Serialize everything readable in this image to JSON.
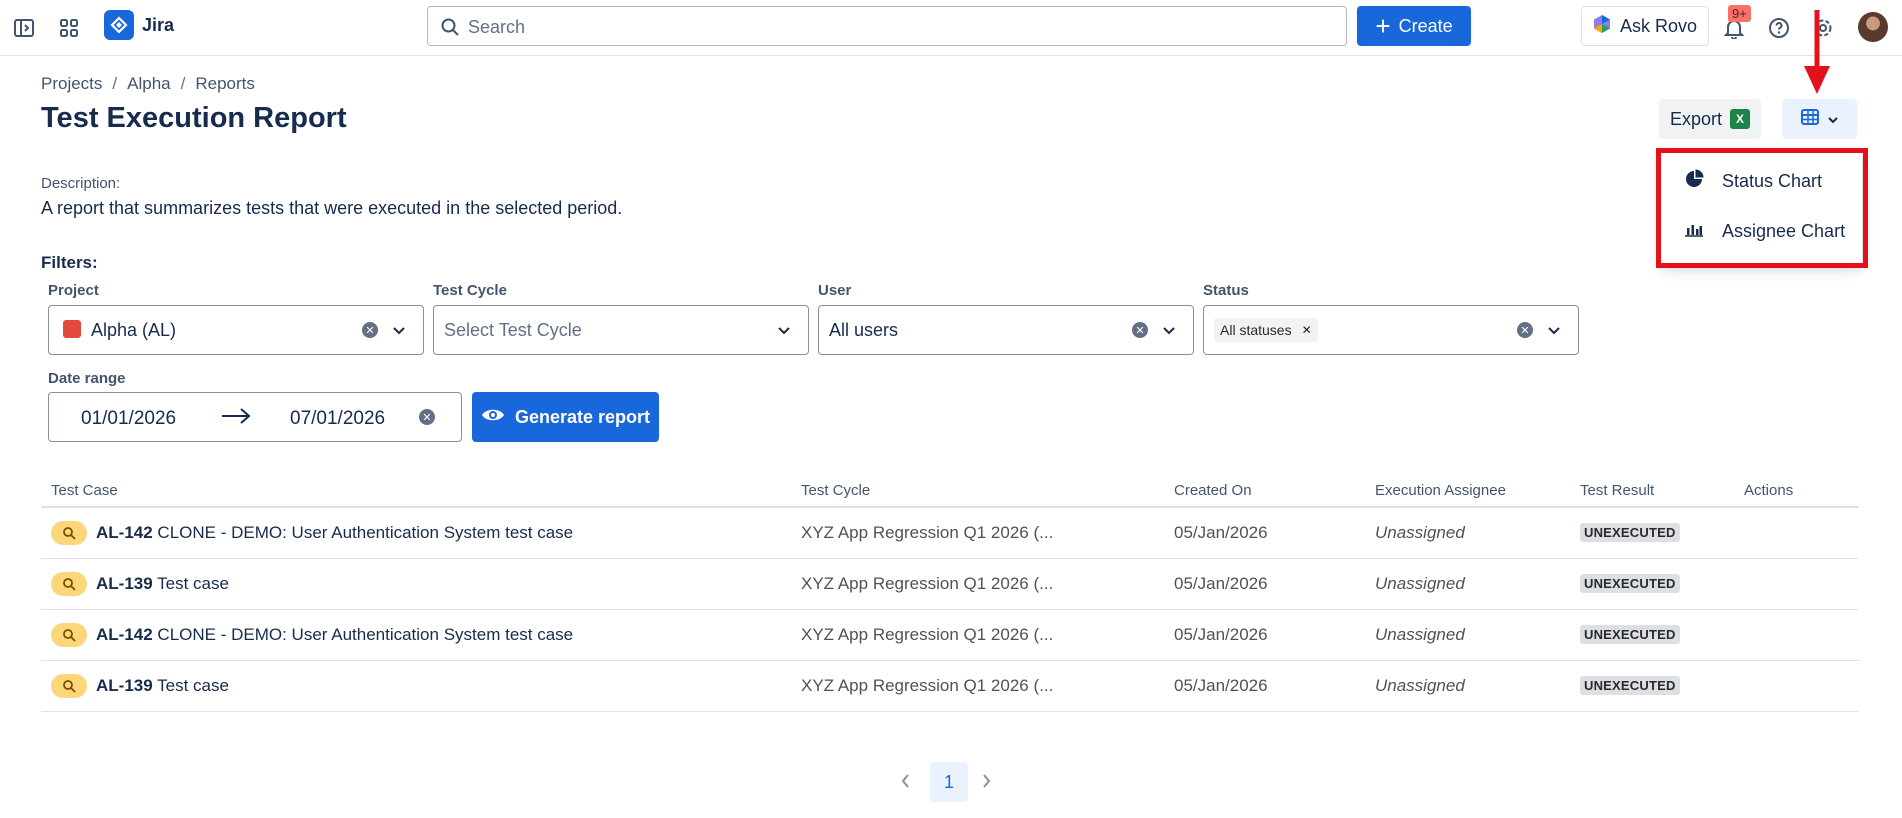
{
  "topbar": {
    "app_name": "Jira",
    "search_placeholder": "Search",
    "create_label": "Create",
    "rovo_label": "Ask Rovo",
    "notifications_count": "9+"
  },
  "breadcrumb": [
    "Projects",
    "Alpha",
    "Reports"
  ],
  "page": {
    "title": "Test Execution Report",
    "export_label": "Export",
    "description_label": "Description:",
    "description_text": "A report that summarizes tests that were executed in the selected period."
  },
  "dropdown": {
    "items": [
      {
        "label": "Status Chart",
        "icon": "pie-chart-icon"
      },
      {
        "label": "Assignee Chart",
        "icon": "bar-chart-icon"
      }
    ]
  },
  "filters": {
    "heading": "Filters:",
    "project": {
      "label": "Project",
      "value": "Alpha (AL)"
    },
    "test_cycle": {
      "label": "Test Cycle",
      "placeholder": "Select Test Cycle"
    },
    "user": {
      "label": "User",
      "value": "All users"
    },
    "status": {
      "label": "Status",
      "tag": "All statuses"
    },
    "date_range": {
      "label": "Date range",
      "from": "01/01/2026",
      "to": "07/01/2026"
    },
    "generate_label": "Generate report"
  },
  "table": {
    "headers": [
      "Test Case",
      "Test Cycle",
      "Created On",
      "Execution Assignee",
      "Test Result",
      "Actions"
    ],
    "rows": [
      {
        "key": "AL-142",
        "name": "CLONE - DEMO: User Authentication System test case",
        "cycle": "XYZ App Regression Q1 2026 (...",
        "created": "05/Jan/2026",
        "assignee": "Unassigned",
        "result": "UNEXECUTED"
      },
      {
        "key": "AL-139",
        "name": "Test case",
        "cycle": "XYZ App Regression Q1 2026 (...",
        "created": "05/Jan/2026",
        "assignee": "Unassigned",
        "result": "UNEXECUTED"
      },
      {
        "key": "AL-142",
        "name": "CLONE - DEMO: User Authentication System test case",
        "cycle": "XYZ App Regression Q1 2026 (...",
        "created": "05/Jan/2026",
        "assignee": "Unassigned",
        "result": "UNEXECUTED"
      },
      {
        "key": "AL-139",
        "name": "Test case",
        "cycle": "XYZ App Regression Q1 2026 (...",
        "created": "05/Jan/2026",
        "assignee": "Unassigned",
        "result": "UNEXECUTED"
      }
    ]
  },
  "pagination": {
    "current_page": "1"
  },
  "colors": {
    "brand": "#1868db",
    "highlight": "#e2121b",
    "result_badge": "#dcdfe4"
  }
}
